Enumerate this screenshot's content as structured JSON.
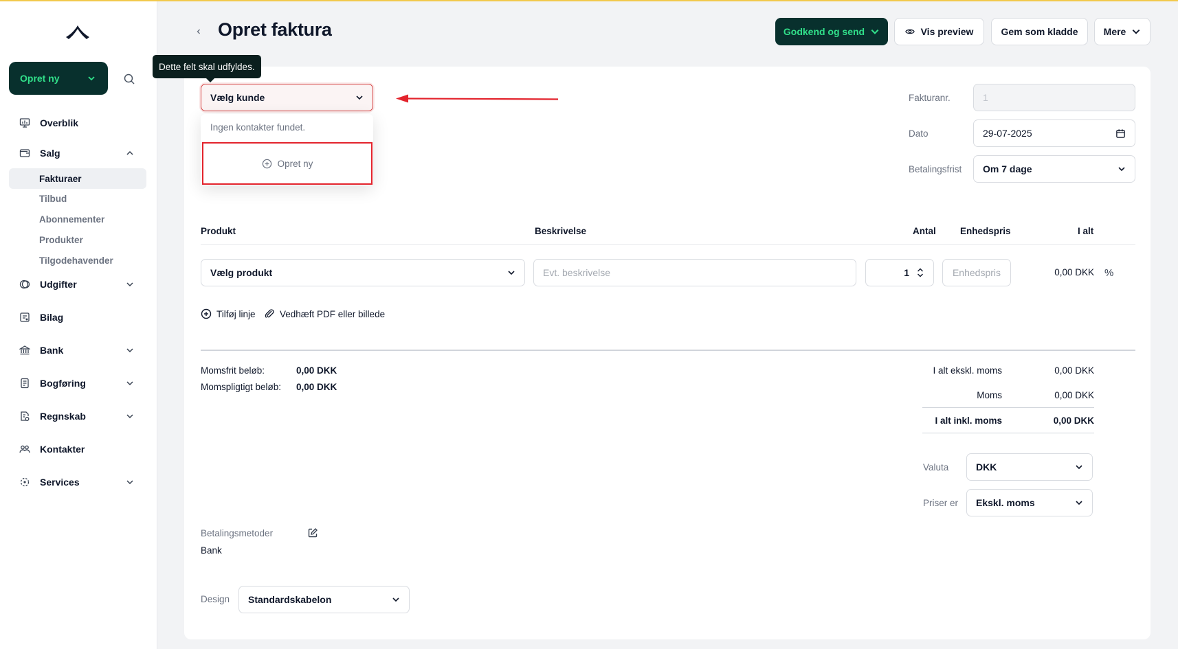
{
  "sidebar": {
    "create_label": "Opret ny",
    "items": [
      {
        "label": "Overblik",
        "icon": "chart-icon"
      },
      {
        "label": "Salg",
        "icon": "wallet-icon",
        "expanded": true
      },
      {
        "label": "Udgifter",
        "icon": "coins-icon"
      },
      {
        "label": "Bilag",
        "icon": "receipt-icon"
      },
      {
        "label": "Bank",
        "icon": "bank-icon"
      },
      {
        "label": "Bogføring",
        "icon": "book-icon"
      },
      {
        "label": "Regnskab",
        "icon": "report-icon"
      },
      {
        "label": "Kontakter",
        "icon": "people-icon"
      },
      {
        "label": "Services",
        "icon": "services-icon"
      }
    ],
    "salg_sub": [
      "Fakturaer",
      "Tilbud",
      "Abonnementer",
      "Produkter",
      "Tilgodehavender"
    ]
  },
  "header": {
    "title": "Opret faktura",
    "approve_label": "Godkend og send",
    "preview_label": "Vis preview",
    "draft_label": "Gem som kladde",
    "more_label": "Mere"
  },
  "customer": {
    "tooltip": "Dette felt skal udfyldes.",
    "select_label": "Vælg kunde",
    "empty_text": "Ingen kontakter fundet.",
    "create_new_label": "Opret ny"
  },
  "invoice": {
    "number_label": "Fakturanr.",
    "number_value": "1",
    "date_label": "Dato",
    "date_value": "29-07-2025",
    "due_label": "Betalingsfrist",
    "due_value": "Om 7 dage"
  },
  "lines": {
    "headers": {
      "product": "Produkt",
      "description": "Beskrivelse",
      "qty": "Antal",
      "unit_price": "Enhedspris",
      "total": "I alt"
    },
    "row": {
      "product_placeholder": "Vælg produkt",
      "description_placeholder": "Evt. beskrivelse",
      "qty": "1",
      "unit_price_placeholder": "Enhedspris",
      "total": "0,00 DKK",
      "discount_symbol": "%"
    },
    "add_line_label": "Tilføj linje",
    "attach_label": "Vedhæft PDF eller billede"
  },
  "totals": {
    "vat_free_label": "Momsfrit beløb:",
    "vat_free_value": "0,00 DKK",
    "vat_liable_label": "Momspligtigt beløb:",
    "vat_liable_value": "0,00 DKK",
    "excl_label": "I alt ekskl. moms",
    "excl_value": "0,00 DKK",
    "vat_label": "Moms",
    "vat_value": "0,00 DKK",
    "incl_label": "I alt inkl. moms",
    "incl_value": "0,00 DKK",
    "currency_label": "Valuta",
    "currency_value": "DKK",
    "prices_label": "Priser er",
    "prices_value": "Ekskl. moms"
  },
  "payment": {
    "label": "Betalingsmetoder",
    "value": "Bank"
  },
  "design": {
    "label": "Design",
    "value": "Standardskabelon"
  },
  "colors": {
    "primary": "#08302d",
    "accent": "#31e08a",
    "error": "#e3232c"
  }
}
